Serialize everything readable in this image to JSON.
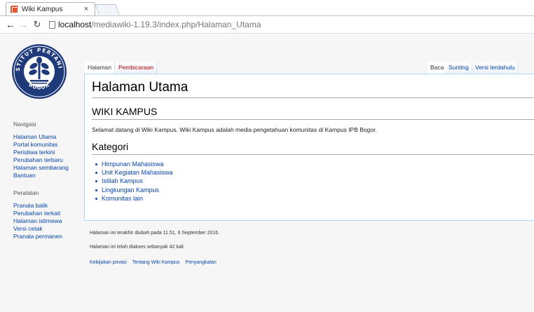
{
  "browser": {
    "tab_title": "Wiki Kampus",
    "tab_close": "×",
    "url_host": "localhost",
    "url_path": "/mediawiki-1.19.3/index.php/Halaman_Utama"
  },
  "logo": {
    "top_text": "INSTITUT PERTANIAN",
    "bottom_text": "BOGOR"
  },
  "page_tabs": {
    "left": [
      "Halaman",
      "Pembicaraan"
    ],
    "right": [
      "Baca",
      "Sunting",
      "Versi terdahulu"
    ]
  },
  "sidebar": {
    "navigation_heading": "Navigasi",
    "navigation_items": [
      "Halaman Utama",
      "Portal komunitas",
      "Peristiwa terkini",
      "Perubahan terbaru",
      "Halaman sembarang",
      "Bantuan"
    ],
    "tools_heading": "Peralatan",
    "tools_items": [
      "Pranala balik",
      "Perubahan terkait",
      "Halaman istimewa",
      "Versi cetak",
      "Pranala permanen"
    ]
  },
  "content": {
    "title": "Halaman Utama",
    "section1_heading": "WIKI KAMPUS",
    "intro_text": "Selamat datang di Wiki Kampus. Wiki Kampus adalah media pengetahuan komunitas di Kampus IPB Bogor.",
    "section2_heading": "Kategori",
    "categories": [
      "Himpunan Mahasiswa",
      "Unit Kegiatan Mahasiswa",
      "Istilah Kampus",
      "Lingkungan Kampus",
      "Komunitas lain"
    ]
  },
  "footer": {
    "last_modified": "Halaman ini terakhir diubah pada 11.51, 6 September 2016.",
    "view_count": "Halaman ini telah diakses sebanyak 42 kali.",
    "links": [
      "Kebijakan privasi",
      "Tentang Wiki Kampus",
      "Penyangkalan"
    ]
  },
  "colors": {
    "link": "#0645ad",
    "new_link": "#ba0000",
    "content_border": "#a7d7f9",
    "page_bg": "#f6f6f6"
  }
}
